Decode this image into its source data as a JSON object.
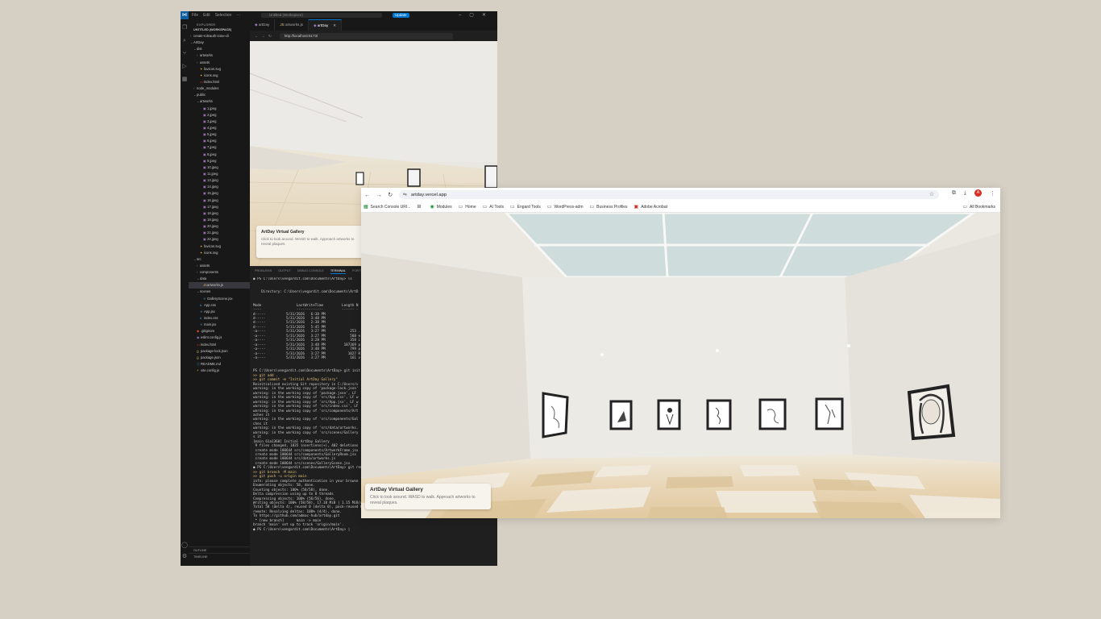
{
  "vscode": {
    "menu": [
      "File",
      "Edit",
      "Selection",
      "···"
    ],
    "title_search": "Untitled (Workspace)",
    "update_label": "Update",
    "explorer_header": "EXPLORER",
    "workspace_label": "UNTITLED (WORKSPACE)",
    "tree": [
      {
        "label": "create-roleauth-zone-cli",
        "depth": 0,
        "type": "folder",
        "open": false
      },
      {
        "label": "ArtDay",
        "depth": 0,
        "type": "folder",
        "open": true
      },
      {
        "label": "dist",
        "depth": 1,
        "type": "folder",
        "open": true
      },
      {
        "label": "artworks",
        "depth": 2,
        "type": "folder",
        "open": false
      },
      {
        "label": "assets",
        "depth": 2,
        "type": "folder",
        "open": false
      },
      {
        "label": "favicon.svg",
        "depth": 2,
        "type": "svg"
      },
      {
        "label": "icons.svg",
        "depth": 2,
        "type": "svg"
      },
      {
        "label": "index.html",
        "depth": 2,
        "type": "html"
      },
      {
        "label": "node_modules",
        "depth": 1,
        "type": "folder",
        "open": false
      },
      {
        "label": "public",
        "depth": 1,
        "type": "folder",
        "open": true
      },
      {
        "label": "artworks",
        "depth": 2,
        "type": "folder",
        "open": true
      },
      {
        "label": "1.jpeg",
        "depth": 3,
        "type": "img"
      },
      {
        "label": "2.jpeg",
        "depth": 3,
        "type": "img"
      },
      {
        "label": "3.jpeg",
        "depth": 3,
        "type": "img"
      },
      {
        "label": "4.jpeg",
        "depth": 3,
        "type": "img"
      },
      {
        "label": "5.jpeg",
        "depth": 3,
        "type": "img"
      },
      {
        "label": "6.jpeg",
        "depth": 3,
        "type": "img"
      },
      {
        "label": "7.jpeg",
        "depth": 3,
        "type": "img"
      },
      {
        "label": "8.jpeg",
        "depth": 3,
        "type": "img"
      },
      {
        "label": "9.jpeg",
        "depth": 3,
        "type": "img"
      },
      {
        "label": "10.jpeg",
        "depth": 3,
        "type": "img"
      },
      {
        "label": "11.jpeg",
        "depth": 3,
        "type": "img"
      },
      {
        "label": "13.jpeg",
        "depth": 3,
        "type": "img"
      },
      {
        "label": "14.jpeg",
        "depth": 3,
        "type": "img"
      },
      {
        "label": "15.jpeg",
        "depth": 3,
        "type": "img"
      },
      {
        "label": "16.jpeg",
        "depth": 3,
        "type": "img"
      },
      {
        "label": "17.jpeg",
        "depth": 3,
        "type": "img"
      },
      {
        "label": "18.jpeg",
        "depth": 3,
        "type": "img"
      },
      {
        "label": "19.jpeg",
        "depth": 3,
        "type": "img"
      },
      {
        "label": "20.jpeg",
        "depth": 3,
        "type": "img"
      },
      {
        "label": "21.jpeg",
        "depth": 3,
        "type": "img"
      },
      {
        "label": "22.jpeg",
        "depth": 3,
        "type": "img"
      },
      {
        "label": "favicon.svg",
        "depth": 2,
        "type": "svg"
      },
      {
        "label": "icons.svg",
        "depth": 2,
        "type": "svg"
      },
      {
        "label": "src",
        "depth": 1,
        "type": "folder",
        "open": true
      },
      {
        "label": "assets",
        "depth": 2,
        "type": "folder",
        "open": false
      },
      {
        "label": "components",
        "depth": 2,
        "type": "folder",
        "open": false
      },
      {
        "label": "data",
        "depth": 2,
        "type": "folder",
        "open": true
      },
      {
        "label": "artworks.js",
        "depth": 3,
        "type": "js",
        "selected": true
      },
      {
        "label": "scenes",
        "depth": 2,
        "type": "folder",
        "open": true
      },
      {
        "label": "GalleryScene.jsx",
        "depth": 3,
        "type": "jsx"
      },
      {
        "label": "App.css",
        "depth": 2,
        "type": "css"
      },
      {
        "label": "App.jsx",
        "depth": 2,
        "type": "jsx"
      },
      {
        "label": "index.css",
        "depth": 2,
        "type": "css"
      },
      {
        "label": "main.jsx",
        "depth": 2,
        "type": "jsx"
      },
      {
        "label": ".gitignore",
        "depth": 1,
        "type": "git"
      },
      {
        "label": "eslint.config.js",
        "depth": 1,
        "type": "eslint"
      },
      {
        "label": "index.html",
        "depth": 1,
        "type": "html"
      },
      {
        "label": "package-lock.json",
        "depth": 1,
        "type": "json"
      },
      {
        "label": "package.json",
        "depth": 1,
        "type": "json"
      },
      {
        "label": "README.md",
        "depth": 1,
        "type": "md"
      },
      {
        "label": "vite.config.js",
        "depth": 1,
        "type": "vite"
      }
    ],
    "outline_label": "OUTLINE",
    "timeline_label": "TIMELINE",
    "tabs": [
      {
        "label": "artDay",
        "active": false
      },
      {
        "label": "artworks.js",
        "active": false
      },
      {
        "label": "artDay",
        "active": true
      }
    ],
    "preview_url": "http://localhost:5173/",
    "preview_plaque": {
      "title": "ArtDay Virtual Gallery",
      "desc": "Click to look around. WASD to walk. Approach artworks to reveal plaques."
    },
    "panel_tabs": [
      "PROBLEMS",
      "OUTPUT",
      "DEBUG CONSOLE",
      "TERMINAL",
      "PORTS"
    ],
    "terminal_lines": [
      {
        "t": "● PS C:\\Users\\vengardit.com\\Documents\\ArtDay> ls",
        "c": ""
      },
      {
        "t": "",
        "c": ""
      },
      {
        "t": "",
        "c": ""
      },
      {
        "t": "    Directory: C:\\Users\\vegardit.com\\Documents\\ArtD",
        "c": ""
      },
      {
        "t": "",
        "c": ""
      },
      {
        "t": "",
        "c": ""
      },
      {
        "t": "Mode                 LastWriteTime         Length N",
        "c": ""
      },
      {
        "t": "----                 -------------         ------ -",
        "c": ""
      },
      {
        "t": "d-----          5/31/2026   6:38 PM                ",
        "c": ""
      },
      {
        "t": "d-----          5/31/2026   3:48 PM                ",
        "c": ""
      },
      {
        "t": "d-----          5/31/2026   2:38 PM                ",
        "c": ""
      },
      {
        "t": "d-----          5/31/2026   5:45 PM                ",
        "c": ""
      },
      {
        "t": "-a----          5/31/2026   3:27 PM            253 .",
        "c": ""
      },
      {
        "t": "-a----          5/31/2026   3:27 PM            588 e",
        "c": ""
      },
      {
        "t": "-a----          5/31/2026   3:28 PM            358 i",
        "c": ""
      },
      {
        "t": "-a----          5/31/2026   3:48 PM         107369 p",
        "c": ""
      },
      {
        "t": "-a----          5/31/2026   3:48 PM            799 p",
        "c": ""
      },
      {
        "t": "-a----          5/31/2026   3:27 PM           1027 R",
        "c": ""
      },
      {
        "t": "-a----          5/31/2026   3:27 PM            161 v",
        "c": ""
      },
      {
        "t": "",
        "c": ""
      },
      {
        "t": "",
        "c": ""
      },
      {
        "t": "PS C:\\Users\\vengardit.com\\Documents\\ArtDay> git init",
        "c": ""
      },
      {
        "t": ">> git add .",
        "c": "y"
      },
      {
        "t": ">> git commit -m \"Initial ArtDay Gallery\"",
        "c": "y"
      },
      {
        "t": "Reinitialized existing Git repository in C:/Users/v",
        "c": ""
      },
      {
        "t": "warning: in the working copy of 'package-lock.json'",
        "c": ""
      },
      {
        "t": "warning: in the working copy of 'package.json', LF ",
        "c": ""
      },
      {
        "t": "warning: in the working copy of 'src/App.css', LF w",
        "c": ""
      },
      {
        "t": "warning: in the working copy of 'src/App.jsx', LF w",
        "c": ""
      },
      {
        "t": "warning: in the working copy of 'src/index.css', LF",
        "c": ""
      },
      {
        "t": "warning: in the working copy of 'src/components/Art",
        "c": ""
      },
      {
        "t": "aches it",
        "c": ""
      },
      {
        "t": "warning: in the working copy of 'src/components/Gal",
        "c": ""
      },
      {
        "t": "ches it",
        "c": ""
      },
      {
        "t": "warning: in the working copy of 'src/data/artworks.",
        "c": ""
      },
      {
        "t": "warning: in the working copy of 'src/scenes/Gallery",
        "c": ""
      },
      {
        "t": "s it",
        "c": ""
      },
      {
        "t": "[main 61a1360] Initial ArtDay Gallery",
        "c": ""
      },
      {
        "t": " 9 files changed, 1835 insertions(+), 402 deletions",
        "c": ""
      },
      {
        "t": " create mode 100644 src/components/ArtworkFrame.jsx",
        "c": ""
      },
      {
        "t": " create mode 100644 src/components/GalleryRoom.jsx",
        "c": ""
      },
      {
        "t": " create mode 100644 src/data/artworks.js",
        "c": ""
      },
      {
        "t": " create mode 100644 src/scenes/GalleryScene.jsx",
        "c": ""
      },
      {
        "t": "● PS C:\\Users\\vengardit.com\\Documents\\ArtDay> git remo",
        "c": ""
      },
      {
        "t": ">> git branch -M main",
        "c": "y"
      },
      {
        "t": ">> git push -u origin main",
        "c": "y"
      },
      {
        "t": "info: please complete authentication in your browse",
        "c": ""
      },
      {
        "t": "Enumerating objects: 58, done.",
        "c": ""
      },
      {
        "t": "Counting objects: 100% (58/58), done.",
        "c": ""
      },
      {
        "t": "Delta compression using up to 8 threads",
        "c": ""
      },
      {
        "t": "Compressing objects: 100% (56/56), done.",
        "c": ""
      },
      {
        "t": "Writing objects: 100% (58/58), 17.18 MiB | 1.15 MiB/s, done.",
        "c": ""
      },
      {
        "t": "Total 58 (delta 4), reused 0 (delta 0), pack-reused 0 (from 0)",
        "c": ""
      },
      {
        "t": "remote: Resolving deltas: 100% (4/4), done.",
        "c": ""
      },
      {
        "t": "To https://github.com/admac-hub/artday.git",
        "c": ""
      },
      {
        "t": " * [new branch]      main -> main",
        "c": ""
      },
      {
        "t": "branch 'main' set up to track 'origin/main'.",
        "c": ""
      },
      {
        "t": "● PS C:\\Users\\vengardit.com\\Documents\\ArtDay> |",
        "c": ""
      }
    ]
  },
  "chrome": {
    "url": "artday.vercel.app",
    "bookmarks": [
      {
        "label": "Search Console URI...",
        "icon": "search-console-icon"
      },
      {
        "label": "",
        "icon": "apps-grid-icon"
      },
      {
        "label": "Modules",
        "icon": "modules-icon"
      },
      {
        "label": "Home",
        "icon": "folder-icon"
      },
      {
        "label": "AI Tools",
        "icon": "folder-icon"
      },
      {
        "label": "Engard Tools",
        "icon": "folder-icon"
      },
      {
        "label": "WordPress-adm",
        "icon": "folder-icon"
      },
      {
        "label": "Business Profiles",
        "icon": "folder-icon"
      },
      {
        "label": "Adobe Acrobat",
        "icon": "acrobat-icon"
      }
    ],
    "all_bookmarks": "All Bookmarks",
    "avatar_letter": "A",
    "plaque": {
      "title": "ArtDay Virtual Gallery",
      "desc": "Click to look around. WASD to walk. Approach artworks to reveal plaques."
    }
  },
  "colors": {
    "desktop_bg": "#d6d0c4",
    "vscode_bg": "#1f1f1f",
    "vscode_accent": "#0078d4",
    "gallery_wall": "#e8e5de",
    "gallery_floor": "#e3cfae"
  }
}
